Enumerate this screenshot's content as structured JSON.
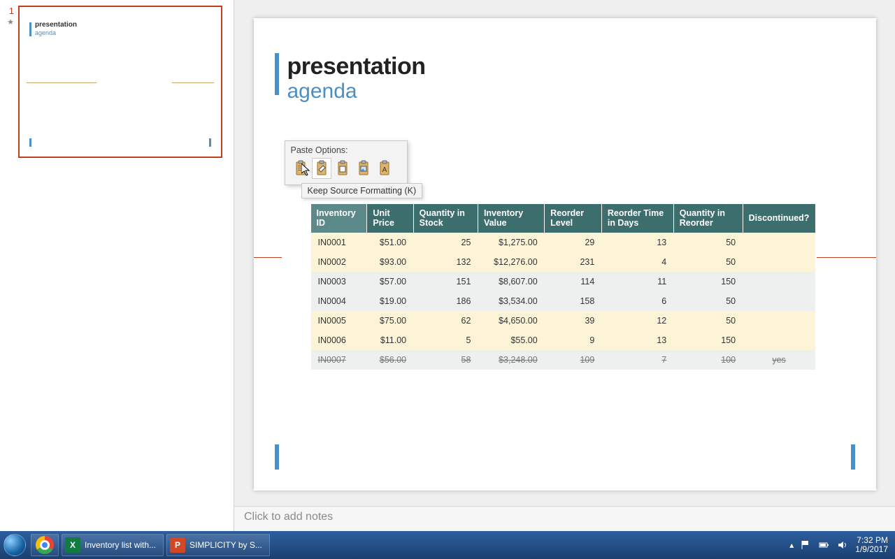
{
  "slide": {
    "title1": "presentation",
    "title2": "agenda"
  },
  "thumbnail": {
    "number": "1",
    "title1": "presentation",
    "title2": "agenda"
  },
  "paste_options": {
    "label": "Paste Options:",
    "tooltip": "Keep Source Formatting (K)"
  },
  "table": {
    "headers": [
      "Inventory ID",
      "Unit Price",
      "Quantity in Stock",
      "Inventory Value",
      "Reorder Level",
      "Reorder Time in Days",
      "Quantity in Reorder",
      "Discontinued?"
    ],
    "rows": [
      {
        "band": "y",
        "id": "IN0001",
        "price": "$51.00",
        "qty": "25",
        "value": "$1,275.00",
        "reorder": "29",
        "days": "13",
        "qreorder": "50",
        "disc": ""
      },
      {
        "band": "y",
        "id": "IN0002",
        "price": "$93.00",
        "qty": "132",
        "value": "$12,276.00",
        "reorder": "231",
        "days": "4",
        "qreorder": "50",
        "disc": ""
      },
      {
        "band": "g",
        "id": "IN0003",
        "price": "$57.00",
        "qty": "151",
        "value": "$8,607.00",
        "reorder": "114",
        "days": "11",
        "qreorder": "150",
        "disc": ""
      },
      {
        "band": "g",
        "id": "IN0004",
        "price": "$19.00",
        "qty": "186",
        "value": "$3,534.00",
        "reorder": "158",
        "days": "6",
        "qreorder": "50",
        "disc": ""
      },
      {
        "band": "y",
        "id": "IN0005",
        "price": "$75.00",
        "qty": "62",
        "value": "$4,650.00",
        "reorder": "39",
        "days": "12",
        "qreorder": "50",
        "disc": ""
      },
      {
        "band": "y",
        "id": "IN0006",
        "price": "$11.00",
        "qty": "5",
        "value": "$55.00",
        "reorder": "9",
        "days": "13",
        "qreorder": "150",
        "disc": ""
      },
      {
        "band": "g",
        "strike": true,
        "id": "IN0007",
        "price": "$56.00",
        "qty": "58",
        "value": "$3,248.00",
        "reorder": "109",
        "days": "7",
        "qreorder": "100",
        "disc": "yes"
      }
    ]
  },
  "notes_placeholder": "Click to add notes",
  "taskbar": {
    "excel": "Inventory list with...",
    "ppt": "SIMPLICITY by S...",
    "time": "7:32 PM",
    "date": "1/9/2017"
  }
}
